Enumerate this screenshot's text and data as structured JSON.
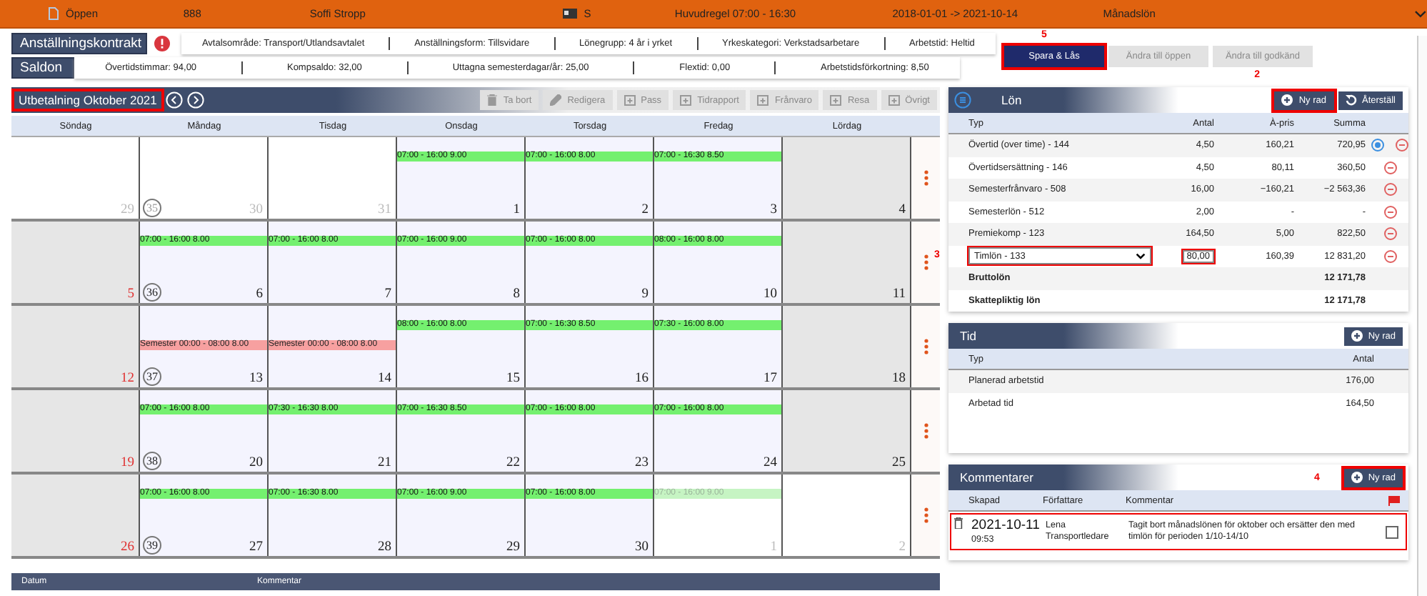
{
  "top_bar": {
    "status": "Öppen",
    "number": "888",
    "name": "Soffi Stropp",
    "card": "S",
    "rule": "Huvudregel 07:00 - 16:30",
    "period": "2018-01-01 -> 2021-10-14",
    "salary_type": "Månadslön"
  },
  "contract": {
    "button": "Anställningskontrakt",
    "fields": [
      "Avtalsområde: Transport/Utlandsavtalet",
      "Anställningsform: Tillsvidare",
      "Lönegrupp: 4 år i yrket",
      "Yrkeskategori: Verkstadsarbetare",
      "Arbetstid: Heltid"
    ]
  },
  "balances": {
    "button": "Saldon",
    "fields": [
      "Övertidstimmar: 94,00",
      "Kompsaldo: 32,00",
      "Uttagna semesterdagar/år: 25,00",
      "Flextid: 0,00",
      "Arbetstidsförkortning: 8,50"
    ]
  },
  "actions": [
    {
      "label": "Spara & Lås",
      "disabled": false,
      "highlighted": true,
      "marker": "5"
    },
    {
      "label": "Ändra till öppen",
      "disabled": true,
      "highlighted": false
    },
    {
      "label": "Ändra till godkänd",
      "disabled": true,
      "highlighted": false
    }
  ],
  "calendar": {
    "title": "Utbetalning Oktober 2021",
    "title_highlighted": true,
    "toolbar": [
      {
        "label": "Ta bort",
        "disabled": true
      },
      {
        "label": "Redigera",
        "disabled": true
      },
      {
        "label": "Pass",
        "disabled": true
      },
      {
        "label": "Tidrapport",
        "disabled": true
      },
      {
        "label": "Frånvaro",
        "disabled": true
      },
      {
        "label": "Resa",
        "disabled": true
      },
      {
        "label": "Övrigt",
        "disabled": true
      }
    ],
    "weekdays": [
      "Söndag",
      "Måndag",
      "Tisdag",
      "Onsdag",
      "Torsdag",
      "Fredag",
      "Lördag"
    ],
    "weeks": [
      {
        "week": "35",
        "days": [
          {
            "day": "29",
            "muted": true,
            "shaded": false
          },
          {
            "day": "30",
            "muted": true,
            "shaded": false
          },
          {
            "day": "31",
            "muted": true,
            "shaded": false
          },
          {
            "day": "1",
            "muted": false,
            "shaded": false,
            "events": [
              {
                "text": "07:00 - 16:00 9.00",
                "kind": "shift"
              }
            ]
          },
          {
            "day": "2",
            "muted": false,
            "shaded": false,
            "events": [
              {
                "text": "07:00 - 16:00 8.00",
                "kind": "shift"
              }
            ]
          },
          {
            "day": "3",
            "muted": false,
            "shaded": false,
            "events": [
              {
                "text": "07:00 - 16:30 8.50",
                "kind": "shift"
              }
            ]
          },
          {
            "day": "4",
            "muted": false,
            "shaded": true
          }
        ]
      },
      {
        "week": "36",
        "days": [
          {
            "day": "5",
            "muted": false,
            "shaded": true
          },
          {
            "day": "6",
            "muted": false,
            "shaded": false,
            "events": [
              {
                "text": "07:00 - 16:00 8.00",
                "kind": "shift"
              }
            ]
          },
          {
            "day": "7",
            "muted": false,
            "shaded": false,
            "events": [
              {
                "text": "07:00 - 16:00 8.00",
                "kind": "shift"
              }
            ]
          },
          {
            "day": "8",
            "muted": false,
            "shaded": false,
            "events": [
              {
                "text": "07:00 - 16:00 9.00",
                "kind": "shift"
              }
            ]
          },
          {
            "day": "9",
            "muted": false,
            "shaded": false,
            "events": [
              {
                "text": "07:00 - 16:00 8.00",
                "kind": "shift"
              }
            ]
          },
          {
            "day": "10",
            "muted": false,
            "shaded": false,
            "events": [
              {
                "text": "08:00 - 16:00 8.00",
                "kind": "shift"
              }
            ]
          },
          {
            "day": "11",
            "muted": false,
            "shaded": true
          }
        ]
      },
      {
        "week": "37",
        "days": [
          {
            "day": "12",
            "muted": false,
            "shaded": true
          },
          {
            "day": "13",
            "muted": false,
            "shaded": false,
            "events": [
              {
                "text": "Semester 00:00 - 08:00 8.00",
                "kind": "absence"
              }
            ]
          },
          {
            "day": "14",
            "muted": false,
            "shaded": false,
            "events": [
              {
                "text": "Semester 00:00 - 08:00 8.00",
                "kind": "absence"
              }
            ]
          },
          {
            "day": "15",
            "muted": false,
            "shaded": false,
            "events": [
              {
                "text": "08:00 - 16:00 8.00",
                "kind": "shift"
              }
            ]
          },
          {
            "day": "16",
            "muted": false,
            "shaded": false,
            "events": [
              {
                "text": "07:00 - 16:30 8.50",
                "kind": "shift"
              }
            ]
          },
          {
            "day": "17",
            "muted": false,
            "shaded": false,
            "events": [
              {
                "text": "07:30 - 16:00 8.00",
                "kind": "shift"
              }
            ]
          },
          {
            "day": "18",
            "muted": false,
            "shaded": true
          }
        ]
      },
      {
        "week": "38",
        "days": [
          {
            "day": "19",
            "muted": false,
            "shaded": true
          },
          {
            "day": "20",
            "muted": false,
            "shaded": false,
            "events": [
              {
                "text": "07:00 - 16:00 8.00",
                "kind": "shift"
              }
            ]
          },
          {
            "day": "21",
            "muted": false,
            "shaded": false,
            "events": [
              {
                "text": "07:30 - 16:30 8.00",
                "kind": "shift"
              }
            ]
          },
          {
            "day": "22",
            "muted": false,
            "shaded": false,
            "events": [
              {
                "text": "07:00 - 16:30 8.50",
                "kind": "shift"
              }
            ]
          },
          {
            "day": "23",
            "muted": false,
            "shaded": false,
            "events": [
              {
                "text": "07:00 - 16:00 8.00",
                "kind": "shift"
              }
            ]
          },
          {
            "day": "24",
            "muted": false,
            "shaded": false,
            "events": [
              {
                "text": "07:00 - 16:00 8.00",
                "kind": "shift"
              }
            ]
          },
          {
            "day": "25",
            "muted": false,
            "shaded": true
          }
        ]
      },
      {
        "week": "39",
        "days": [
          {
            "day": "26",
            "muted": false,
            "shaded": true
          },
          {
            "day": "27",
            "muted": false,
            "shaded": false,
            "events": [
              {
                "text": "07:00 - 16:00 8.00",
                "kind": "shift"
              }
            ]
          },
          {
            "day": "28",
            "muted": false,
            "shaded": false,
            "events": [
              {
                "text": "07:00 - 16:30 8.00",
                "kind": "shift"
              }
            ]
          },
          {
            "day": "29",
            "muted": false,
            "shaded": false,
            "events": [
              {
                "text": "07:00 - 16:00 9.00",
                "kind": "shift"
              }
            ]
          },
          {
            "day": "30",
            "muted": false,
            "shaded": false,
            "events": [
              {
                "text": "07:00 - 16:00 8.00",
                "kind": "shift"
              }
            ]
          },
          {
            "day": "1",
            "muted": true,
            "shaded": false,
            "events": [
              {
                "text": "07:00 - 16:00 9.00",
                "kind": "preliminary"
              }
            ]
          },
          {
            "day": "2",
            "muted": true,
            "shaded": false
          }
        ]
      }
    ],
    "list_columns": [
      "Datum",
      "Kommentar"
    ]
  },
  "salary": {
    "title": "Lön",
    "add_button": {
      "label": "Ny rad",
      "highlighted": true,
      "marker": "2"
    },
    "reset_button": "Återställ",
    "columns": [
      "Typ",
      "Antal",
      "À-pris",
      "Summa"
    ],
    "rows": [
      {
        "kind": "line",
        "type": "Övertid (over time) - 144",
        "antal": "4,50",
        "apris": "160,21",
        "summa": "720,95",
        "info": true
      },
      {
        "kind": "line",
        "type": "Övertidsersättning - 146",
        "antal": "4,50",
        "apris": "80,11",
        "summa": "360,50",
        "info": false
      },
      {
        "kind": "line",
        "type": "Semesterfrånvaro - 508",
        "antal": "16,00",
        "apris": "−160,21",
        "summa": "−2 563,36",
        "info": false
      },
      {
        "kind": "line",
        "type": "Semesterlön - 512",
        "antal": "2,00",
        "apris": "-",
        "summa": "-",
        "info": false
      },
      {
        "kind": "line",
        "type": "Premiekomp - 123",
        "antal": "164,50",
        "apris": "5,00",
        "summa": "822,50",
        "info": false
      },
      {
        "kind": "edit",
        "type": "Timlön - 133",
        "antal": "80,00",
        "apris": "160,39",
        "summa": "12 831,20",
        "info": false,
        "highlighted": true,
        "marker": "3"
      }
    ],
    "totals": [
      {
        "label": "Bruttolön",
        "summa": "12 171,78"
      },
      {
        "label": "Skattepliktig lön",
        "summa": "12 171,78"
      }
    ]
  },
  "time": {
    "title": "Tid",
    "add_button": {
      "label": "Ny rad",
      "highlighted": false
    },
    "columns": [
      "Typ",
      "Antal"
    ],
    "rows": [
      {
        "type": "Planerad arbetstid",
        "antal": "176,00"
      },
      {
        "type": "Arbetad tid",
        "antal": "164,50"
      }
    ]
  },
  "comments": {
    "title": "Kommentarer",
    "add_button": {
      "label": "Ny rad",
      "highlighted": true,
      "marker": "4"
    },
    "columns": [
      "Skapad",
      "Författare",
      "Kommentar"
    ],
    "rows": [
      {
        "date": "2021-10-11",
        "time": "09:53",
        "author": "Lena Transportledare",
        "text": "Tagit bort månadslönen för oktober och ersätter den med timlön för perioden 1/10-14/10",
        "checked": false,
        "highlighted": true
      }
    ]
  }
}
